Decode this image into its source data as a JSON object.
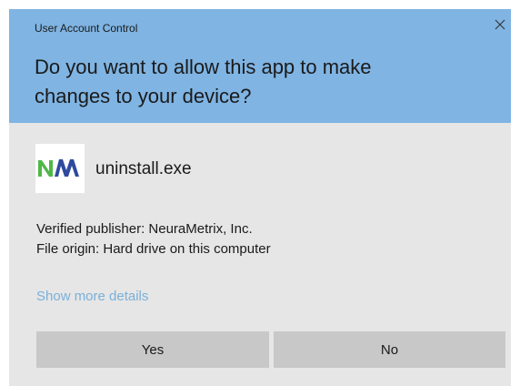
{
  "window": {
    "title": "User Account Control",
    "close_icon": "close-icon"
  },
  "prompt": {
    "line1": "Do you want to allow this app to make",
    "line2": "changes to your device?"
  },
  "app": {
    "logo_icon": "neurametrix-logo",
    "name": "uninstall.exe"
  },
  "details": {
    "publisher": "Verified publisher: NeuraMetrix, Inc.",
    "origin": "File origin: Hard drive on this computer",
    "more_link": "Show more details"
  },
  "buttons": {
    "yes": "Yes",
    "no": "No"
  },
  "colors": {
    "header_bg": "#7fb4e3",
    "body_bg": "#e6e6e6",
    "button_bg": "#c8c8c8",
    "link": "#7ab0da",
    "logo_green": "#4fb848",
    "logo_blue": "#2e4a9e"
  }
}
